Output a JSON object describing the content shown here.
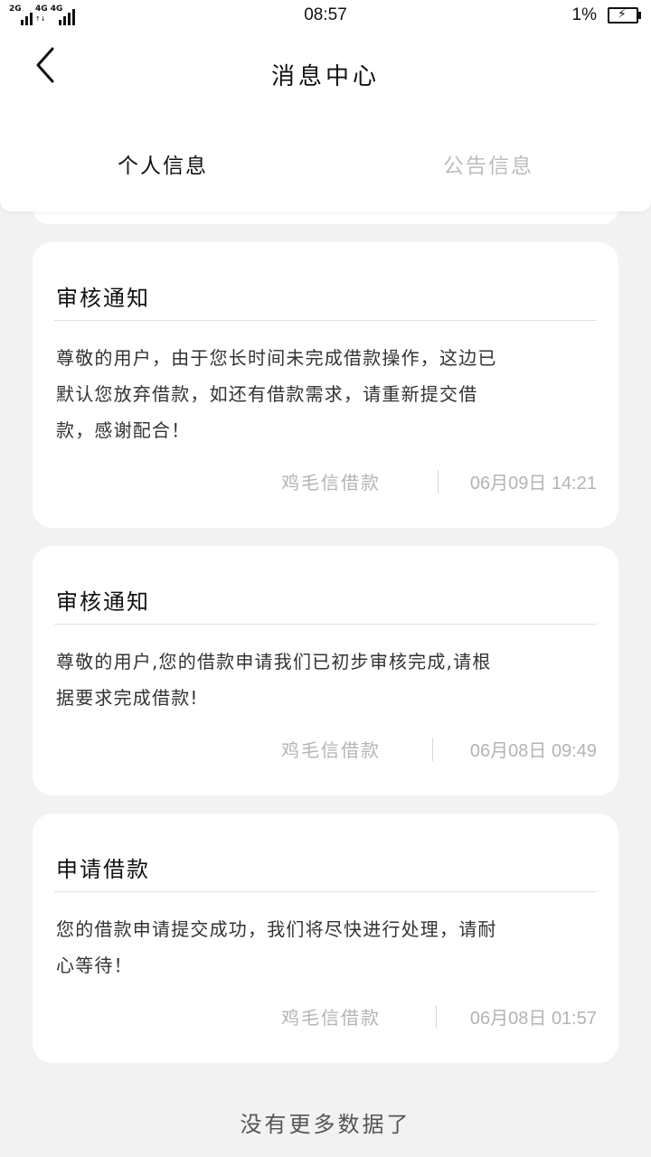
{
  "status_bar": {
    "net1": "2G",
    "net2": "4G 4G",
    "time": "08:57",
    "battery_pct": "1%",
    "battery_icon": "battery-charging-icon"
  },
  "header": {
    "back_icon": "chevron-left-icon",
    "title": "消息中心"
  },
  "tabs": [
    {
      "label": "个人信息",
      "active": true
    },
    {
      "label": "公告信息",
      "active": false
    }
  ],
  "messages": [
    {
      "title": "审核通知",
      "body_lines": [
        "尊敬的用户，由于您长时间未完成借款操作，这边已",
        "默认您放弃借款，如还有借款需求，请重新提交借",
        "款，感谢配合！"
      ],
      "source": "鸡毛信借款",
      "time": "06月09日 14:21"
    },
    {
      "title": "审核通知",
      "body_lines": [
        "尊敬的用户,您的借款申请我们已初步审核完成,请根",
        "据要求完成借款!"
      ],
      "source": "鸡毛信借款",
      "time": "06月08日 09:49"
    },
    {
      "title": "申请借款",
      "body_lines": [
        "您的借款申请提交成功，我们将尽快进行处理，请耐",
        "心等待！"
      ],
      "source": "鸡毛信借款",
      "time": "06月08日 01:57"
    }
  ],
  "no_more_text": "没有更多数据了"
}
